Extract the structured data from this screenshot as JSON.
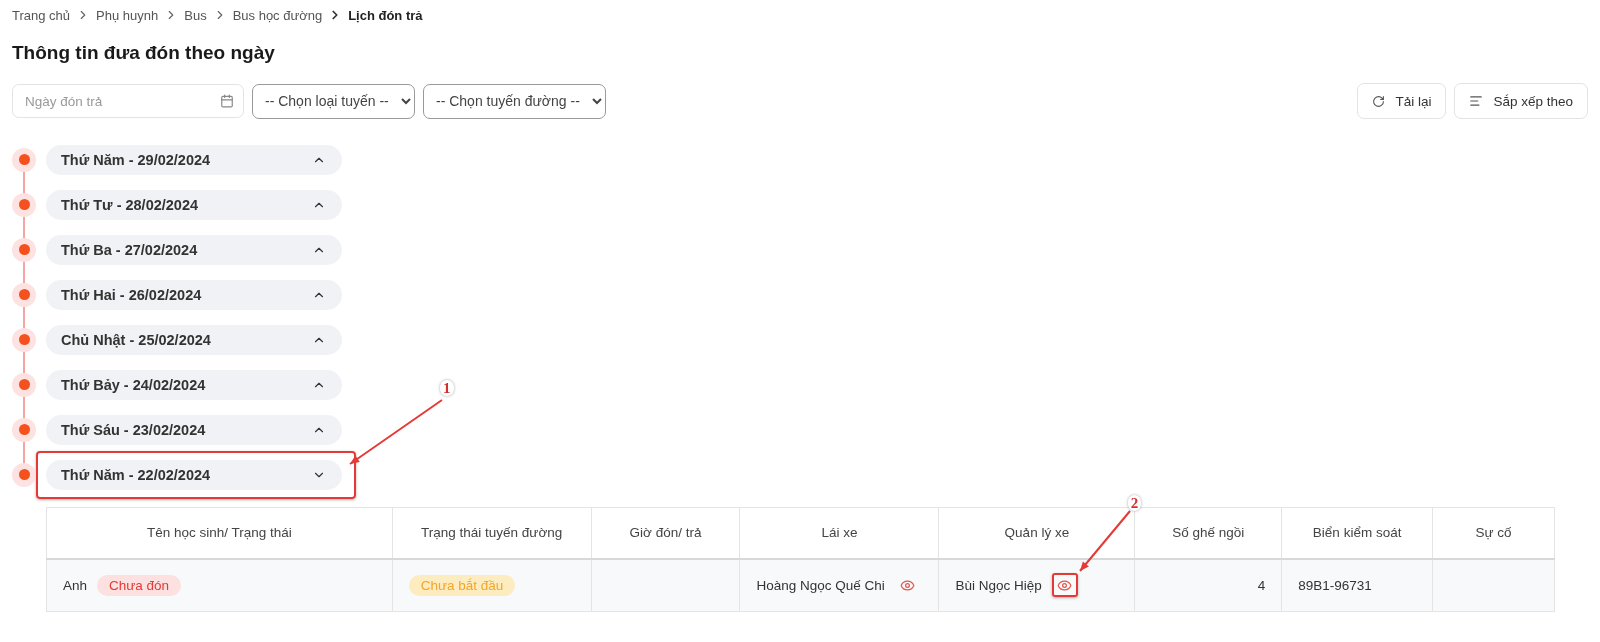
{
  "breadcrumb": [
    {
      "label": "Trang chủ",
      "current": false
    },
    {
      "label": "Phụ huynh",
      "current": false
    },
    {
      "label": "Bus",
      "current": false
    },
    {
      "label": "Bus học đường",
      "current": false
    },
    {
      "label": "Lịch đón trả",
      "current": true
    }
  ],
  "title": "Thông tin đưa đón theo ngày",
  "filters": {
    "date_placeholder": "Ngày đón trả",
    "route_type": "-- Chọn loại tuyến --",
    "route": "-- Chọn tuyến đường --"
  },
  "buttons": [
    {
      "kind": "reload",
      "label": "Tải lại"
    },
    {
      "kind": "sort",
      "label": "Sắp xếp theo"
    }
  ],
  "days": [
    {
      "label": "Thứ Năm - 29/02/2024",
      "expanded": false
    },
    {
      "label": "Thứ Tư - 28/02/2024",
      "expanded": false
    },
    {
      "label": "Thứ Ba - 27/02/2024",
      "expanded": false
    },
    {
      "label": "Thứ Hai - 26/02/2024",
      "expanded": false
    },
    {
      "label": "Chủ Nhật - 25/02/2024",
      "expanded": false
    },
    {
      "label": "Thứ Bảy - 24/02/2024",
      "expanded": false
    },
    {
      "label": "Thứ Sáu - 23/02/2024",
      "expanded": false
    },
    {
      "label": "Thứ Năm - 22/02/2024",
      "expanded": true,
      "callout": "1"
    }
  ],
  "table": {
    "columns": [
      "Tên học sinh/ Trạng thái",
      "Trạng thái tuyến đường",
      "Giờ đón/ trả",
      "Lái xe",
      "Quản lý xe",
      "Số ghế ngồi",
      "Biển kiểm soát",
      "Sự cố"
    ],
    "rows": [
      {
        "student": "Anh",
        "student_status": "Chưa đón",
        "route_status": "Chưa bắt đầu",
        "driver": "Hoàng Ngọc Quế Chi",
        "manager": "Bùi Ngọc Hiệp",
        "manager_callout": "2",
        "seats": "4",
        "plate": "89B1-96731"
      }
    ]
  }
}
